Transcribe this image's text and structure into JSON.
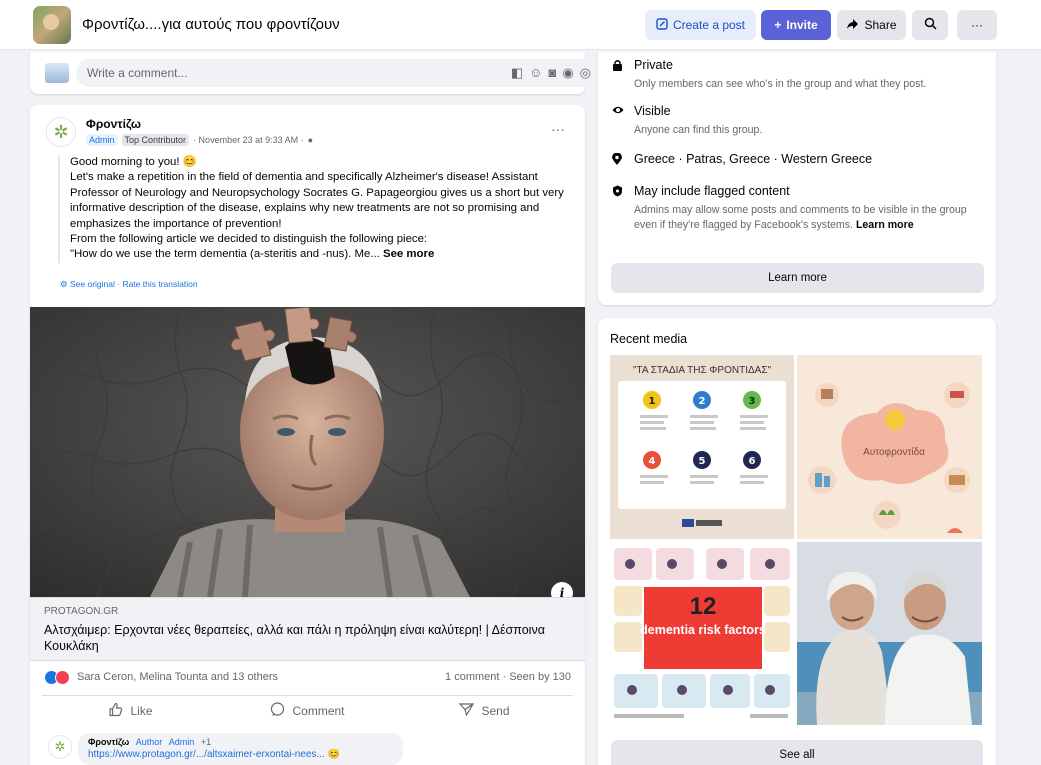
{
  "header": {
    "group_name": "Φροντίζω....για αυτούς που φροντίζουν",
    "create_post": "Create a post",
    "invite": "Invite",
    "share": "Share",
    "more_icon": "more-icon",
    "search_icon": "search-icon"
  },
  "comment_box": {
    "placeholder": "Write a comment..."
  },
  "post": {
    "author": "Φροντίζω",
    "badge_admin": "Admin",
    "badge_contributor": "Top Contributor",
    "timestamp": "· November 23 at 9:33 AM ·",
    "body_line1": "Good morning to you! 😊",
    "body_main": "Let's make a repetition in the field of dementia and specifically Alzheimer's disease! Assistant Professor of Neurology and Neuropsychology Socrates G. Papageorgiou gives us a short but very informative description of the disease, explains why new treatments are not so promising and emphasizes the importance of prevention!",
    "body_line3": "From the following article we decided to distinguish the following piece:",
    "body_line4": "\"How do we use the term dementia (a-steritis and -nus). Me...",
    "see_more": "See more",
    "translate": "See original · Rate this translation",
    "link_domain": "PROTAGON.GR",
    "link_title": "Αλτσχάιμερ: Ερχονται νέες θεραπείες, αλλά και πάλι η πρόληψη είναι καλύτερη! | Δέσποινα Κουκλάκη",
    "reactions_names": "Sara Ceron, Melina Tounta and 13 others",
    "reactions_stats": "1 comment · Seen by 130",
    "action_like": "Like",
    "action_comment": "Comment",
    "action_send": "Send",
    "reply_author": "Φροντίζω",
    "reply_tag1": "Author",
    "reply_tag2": "Admin",
    "reply_tag3": "+1",
    "reply_link": "https://www.protagon.gr/.../altsxaimer-erxontai-nees... 😊"
  },
  "about": {
    "private_label": "Private",
    "private_desc": "Only members can see who's in the group and what they post.",
    "visible_label": "Visible",
    "visible_desc": "Anyone can find this group.",
    "location": "Greece · Patras, Greece · Western Greece",
    "flagged_label": "May include flagged content",
    "flagged_desc": "Admins may allow some posts and comments to be visible in the group even if they're flagged by Facebook's systems.",
    "flagged_learn": "Learn more",
    "learn_more_button": "Learn more"
  },
  "media": {
    "title": "Recent media",
    "tile1_heading": "\"ΤΑ ΣΤΑΔΙΑ ΤΗΣ ΦΡΟΝΤΙΔΑΣ\"",
    "tile1_numbers": [
      "1",
      "2",
      "3",
      "4",
      "5",
      "6"
    ],
    "tile2_label": "Αυτοφροντίδα",
    "tile3_number": "12",
    "tile3_text": "dementia risk factors",
    "see_all": "See all"
  }
}
